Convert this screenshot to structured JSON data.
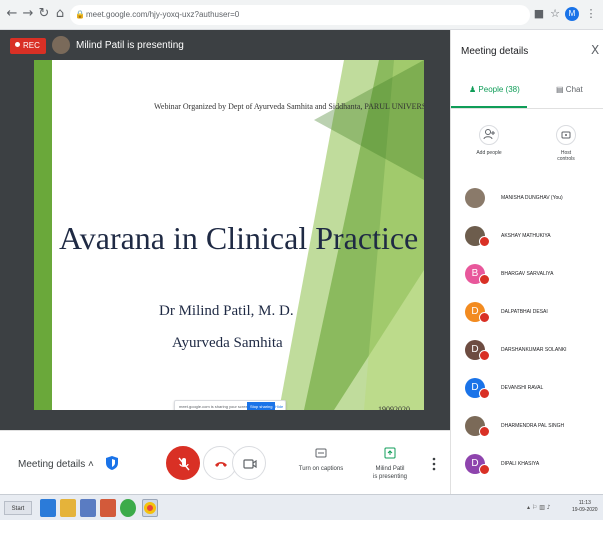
{
  "browser": {
    "url": "meet.google.com/hjy-yoxq-uxz?authuser=0",
    "profile_letter": "M"
  },
  "stage": {
    "rec_label": "REC",
    "presenter_label": "Milind Patil is presenting"
  },
  "slide": {
    "header": "Webinar Organized by Dept of Ayurveda Samhita and Siddhanta, PARUL UNIVERSITY",
    "title": "Avarana in Clinical Practice",
    "author": "Dr Milind Patil, M. D.",
    "department": "Ayurveda Samhita",
    "date": "19092020",
    "share_text": "meet.google.com is sharing your screen.",
    "share_stop": "Stop sharing",
    "share_hide": "Hide"
  },
  "controls": {
    "meeting_details": "Meeting details",
    "captions_label": "Turn on captions",
    "presenting_label_1": "Milind Patil",
    "presenting_label_2": "is presenting"
  },
  "panel": {
    "title": "Meeting details",
    "close": "X",
    "tab_people": "People (38)",
    "tab_chat": "Chat",
    "add_people": "Add people",
    "host_controls_1": "Host",
    "host_controls_2": "controls",
    "participants": [
      {
        "name": "MANISHA DUNGHAV (You)",
        "initial": "",
        "color": "#8a7a6a"
      },
      {
        "name": "AKSHAY MATHUKIYA",
        "initial": "",
        "color": "#6d5d4d"
      },
      {
        "name": "BHARGAV SARVALIYA",
        "initial": "B",
        "color": "#e8579b"
      },
      {
        "name": "DALPATBHAI DESAI",
        "initial": "D",
        "color": "#f28b20"
      },
      {
        "name": "DARSHANKUMAR SOLANKI",
        "initial": "D",
        "color": "#6d4c41"
      },
      {
        "name": "DEVANSHI RAVAL",
        "initial": "D",
        "color": "#1a73e8"
      },
      {
        "name": "DHARMENDRA PAL SINGH",
        "initial": "",
        "color": "#7b6a58"
      },
      {
        "name": "DIPALI KHASIYA",
        "initial": "D",
        "color": "#8e44ad"
      }
    ]
  },
  "taskbar": {
    "start": "Start",
    "clock_time": "11:13",
    "clock_date": "19-09-2020"
  }
}
